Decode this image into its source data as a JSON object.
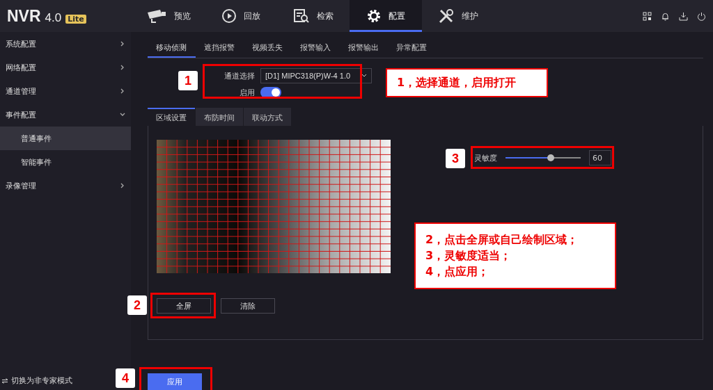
{
  "topbar": {
    "logo": "NVR",
    "version": "4.0",
    "edition": "Lite",
    "nav": [
      {
        "label": "预览",
        "kind": "camera",
        "selected": false
      },
      {
        "label": "回放",
        "kind": "playback",
        "selected": false
      },
      {
        "label": "检索",
        "kind": "search",
        "selected": false
      },
      {
        "label": "配置",
        "kind": "settings",
        "selected": true
      },
      {
        "label": "维护",
        "kind": "tools",
        "selected": false
      }
    ]
  },
  "sidebar": {
    "items": [
      {
        "label": "系统配置",
        "expanded": false
      },
      {
        "label": "网络配置",
        "expanded": false
      },
      {
        "label": "通道管理",
        "expanded": false
      },
      {
        "label": "事件配置",
        "expanded": true,
        "children": [
          {
            "label": "普通事件",
            "selected": true
          },
          {
            "label": "智能事件",
            "selected": false
          }
        ]
      },
      {
        "label": "录像管理",
        "expanded": false
      }
    ],
    "mode_switch": "切换为非专家模式"
  },
  "event_tabs": [
    {
      "label": "移动侦测",
      "selected": true
    },
    {
      "label": "遮挡报警",
      "selected": false
    },
    {
      "label": "视频丢失",
      "selected": false
    },
    {
      "label": "报警输入",
      "selected": false
    },
    {
      "label": "报警输出",
      "selected": false
    },
    {
      "label": "异常配置",
      "selected": false
    }
  ],
  "channel": {
    "label": "通道选择",
    "value": "[D1] MIPC318(P)W-4 1.0"
  },
  "enable": {
    "label": "启用",
    "on": true
  },
  "region_tabs": [
    {
      "label": "区域设置",
      "selected": true
    },
    {
      "label": "布防时间",
      "selected": false
    },
    {
      "label": "联动方式",
      "selected": false
    }
  ],
  "sensitivity": {
    "label": "灵敏度",
    "level": 0.6,
    "value": "60"
  },
  "region_buttons": [
    "全屏",
    "清除"
  ],
  "apply_button": "应用",
  "annotations": [
    {
      "kind": "badge",
      "text": "1"
    },
    {
      "kind": "note",
      "lines": [
        "1，选择通道，启用打开"
      ]
    },
    {
      "kind": "badge",
      "text": "3"
    },
    {
      "kind": "note",
      "lines": [
        "2，点击全屏或自己绘制区域；",
        "3，灵敏度适当；",
        "4，点应用；"
      ]
    },
    {
      "kind": "badge",
      "text": "2"
    },
    {
      "kind": "badge",
      "text": "4"
    }
  ]
}
